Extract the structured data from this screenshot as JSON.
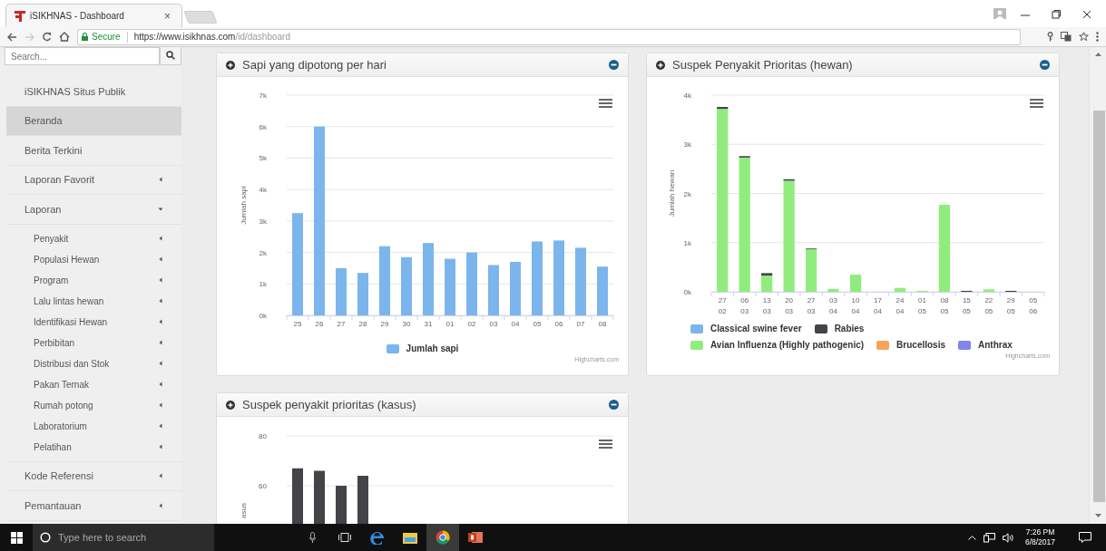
{
  "browser": {
    "tab": {
      "title": "iSIKHNAS - Dashboard",
      "close": "×"
    },
    "address": {
      "security": "Secure",
      "url_host": "https://www.isikhnas.com",
      "url_path": "/id/dashboard"
    }
  },
  "sidebar": {
    "search": {
      "placeholder": "Search..."
    },
    "items": [
      {
        "label": "iSIKHNAS Situs Publik",
        "kind": "link",
        "selected": false
      },
      {
        "label": "Beranda",
        "kind": "link",
        "selected": true
      },
      {
        "label": "Berita Terkini",
        "kind": "link",
        "selected": false
      },
      {
        "label": "Laporan Favorit",
        "kind": "menu",
        "expanded": false,
        "selected": false
      },
      {
        "label": "Laporan",
        "kind": "menu",
        "expanded": true,
        "selected": false,
        "children": [
          {
            "label": "Penyakit",
            "kind": "menu",
            "expanded": false,
            "selected": false
          },
          {
            "label": "Populasi Hewan",
            "kind": "menu",
            "expanded": false,
            "selected": false
          },
          {
            "label": "Program",
            "kind": "menu",
            "expanded": false,
            "selected": false
          },
          {
            "label": "Lalu lintas hewan",
            "kind": "menu",
            "expanded": false,
            "selected": false
          },
          {
            "label": "Identifikasi Hewan",
            "kind": "menu",
            "expanded": false,
            "selected": false
          },
          {
            "label": "Perbibitan",
            "kind": "menu",
            "expanded": false,
            "selected": false
          },
          {
            "label": "Distribusi dan Stok",
            "kind": "menu",
            "expanded": false,
            "selected": false
          },
          {
            "label": "Pakan Ternak",
            "kind": "menu",
            "expanded": false,
            "selected": false
          },
          {
            "label": "Rumah potong",
            "kind": "menu",
            "expanded": false,
            "selected": false
          },
          {
            "label": "Laboratorium",
            "kind": "menu",
            "expanded": false,
            "selected": false
          },
          {
            "label": "Pelatihan",
            "kind": "menu",
            "expanded": false,
            "selected": false
          }
        ]
      },
      {
        "label": "Kode Referensi",
        "kind": "menu",
        "expanded": false,
        "selected": false
      },
      {
        "label": "Pemantauan",
        "kind": "menu",
        "expanded": false,
        "selected": false
      }
    ]
  },
  "panels": [
    {
      "title": "Sapi yang dipotong per hari",
      "credit": "Highcharts.com",
      "chart_data": {
        "type": "bar",
        "grid": true,
        "legend": "bottom",
        "ylabel": "Jumlah sapi",
        "categories": [
          "25",
          "26",
          "27",
          "28",
          "29",
          "30",
          "31",
          "01",
          "02",
          "03",
          "04",
          "05",
          "06",
          "07",
          "08"
        ],
        "ylim": [
          0,
          7000
        ],
        "yticks": [
          {
            "value": 0,
            "label": "0k"
          },
          {
            "value": 1000,
            "label": "1k"
          },
          {
            "value": 2000,
            "label": "2k"
          },
          {
            "value": 3000,
            "label": "3k"
          },
          {
            "value": 4000,
            "label": "4k"
          },
          {
            "value": 5000,
            "label": "5k"
          },
          {
            "value": 6000,
            "label": "6k"
          },
          {
            "value": 7000,
            "label": "7k"
          }
        ],
        "series": [
          {
            "name": "Jumlah sapi",
            "color": "#7cb5ec",
            "values": [
              3250,
              6000,
              1500,
              1350,
              2200,
              1850,
              2300,
              1800,
              2000,
              1600,
              1700,
              2350,
              2380,
              2150,
              1550
            ]
          }
        ]
      }
    },
    {
      "title": "Suspek Penyakit Prioritas (hewan)",
      "credit": "Highcharts.com",
      "chart_data": {
        "type": "bar",
        "stacked": true,
        "grid": true,
        "legend": "bottom",
        "ylabel": "Jumlah hewan",
        "categories": [
          "27 02",
          "06 03",
          "13 03",
          "20 03",
          "27 03",
          "03 04",
          "10 04",
          "17 04",
          "24 04",
          "01 05",
          "08 05",
          "15 05",
          "22 05",
          "29 05",
          "05 06"
        ],
        "ylim": [
          0,
          4000
        ],
        "yticks": [
          {
            "value": 0,
            "label": "0k"
          },
          {
            "value": 1000,
            "label": "1k"
          },
          {
            "value": 2000,
            "label": "2k"
          },
          {
            "value": 3000,
            "label": "3k"
          },
          {
            "value": 4000,
            "label": "4k"
          }
        ],
        "series": [
          {
            "name": "Classical swine fever",
            "color": "#7cb5ec",
            "values": [
              0,
              0,
              0,
              0,
              0,
              0,
              0,
              0,
              0,
              0,
              0,
              0,
              0,
              0,
              0
            ]
          },
          {
            "name": "Rabies",
            "color": "#434348",
            "values": [
              40,
              30,
              50,
              30,
              10,
              0,
              0,
              0,
              0,
              0,
              0,
              20,
              0,
              20,
              0
            ]
          },
          {
            "name": "Avian Influenza (Highly pathogenic)",
            "color": "#90ed7d",
            "values": [
              3720,
              2730,
              330,
              2260,
              870,
              60,
              350,
              0,
              80,
              20,
              1770,
              0,
              50,
              0,
              0
            ]
          },
          {
            "name": "Brucellosis",
            "color": "#f7a35c",
            "values": [
              0,
              0,
              0,
              0,
              0,
              0,
              0,
              0,
              0,
              0,
              0,
              0,
              0,
              0,
              0
            ]
          },
          {
            "name": "Anthrax",
            "color": "#8085e9",
            "values": [
              0,
              0,
              0,
              0,
              0,
              0,
              0,
              0,
              0,
              0,
              0,
              0,
              0,
              0,
              0
            ]
          }
        ]
      }
    },
    {
      "title": "Suspek penyakit prioritas (kasus)",
      "chart_data": {
        "type": "bar",
        "grid": true,
        "ylabel": "asus",
        "ylim": [
          0,
          80
        ],
        "yticks": [
          60,
          80
        ],
        "series": [
          {
            "color": "#434348",
            "values": [
              67,
              66,
              60,
              64,
              null,
              null,
              null,
              null,
              null,
              null,
              null,
              null,
              null,
              null,
              null
            ]
          }
        ]
      }
    }
  ],
  "taskbar": {
    "search": {
      "placeholder": "Type here to search"
    },
    "time": "7:26 PM",
    "date": "6/8/2017"
  }
}
